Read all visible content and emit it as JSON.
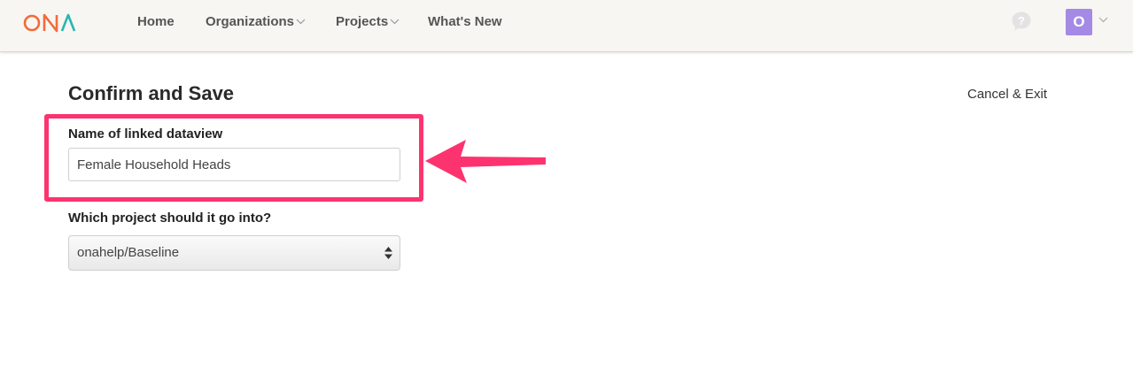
{
  "brand": {
    "logo_text": "ONA",
    "colors": {
      "orange": "#f26b3a",
      "teal": "#2bb5b2",
      "accent": "#fd3370",
      "avatar": "#a48ae5"
    }
  },
  "nav": {
    "home": "Home",
    "organizations": "Organizations",
    "projects": "Projects",
    "whats_new": "What's New",
    "help_icon": "question-bubble-icon",
    "user_initial": "O"
  },
  "page": {
    "title": "Confirm and Save",
    "cancel_label": "Cancel & Exit"
  },
  "form": {
    "name_label": "Name of linked dataview",
    "name_value": "Female Household Heads",
    "project_label": "Which project should it go into?",
    "project_selected": "onahelp/Baseline"
  },
  "annotation": {
    "shape": "highlight-box-with-arrow",
    "color": "#fd3370"
  }
}
